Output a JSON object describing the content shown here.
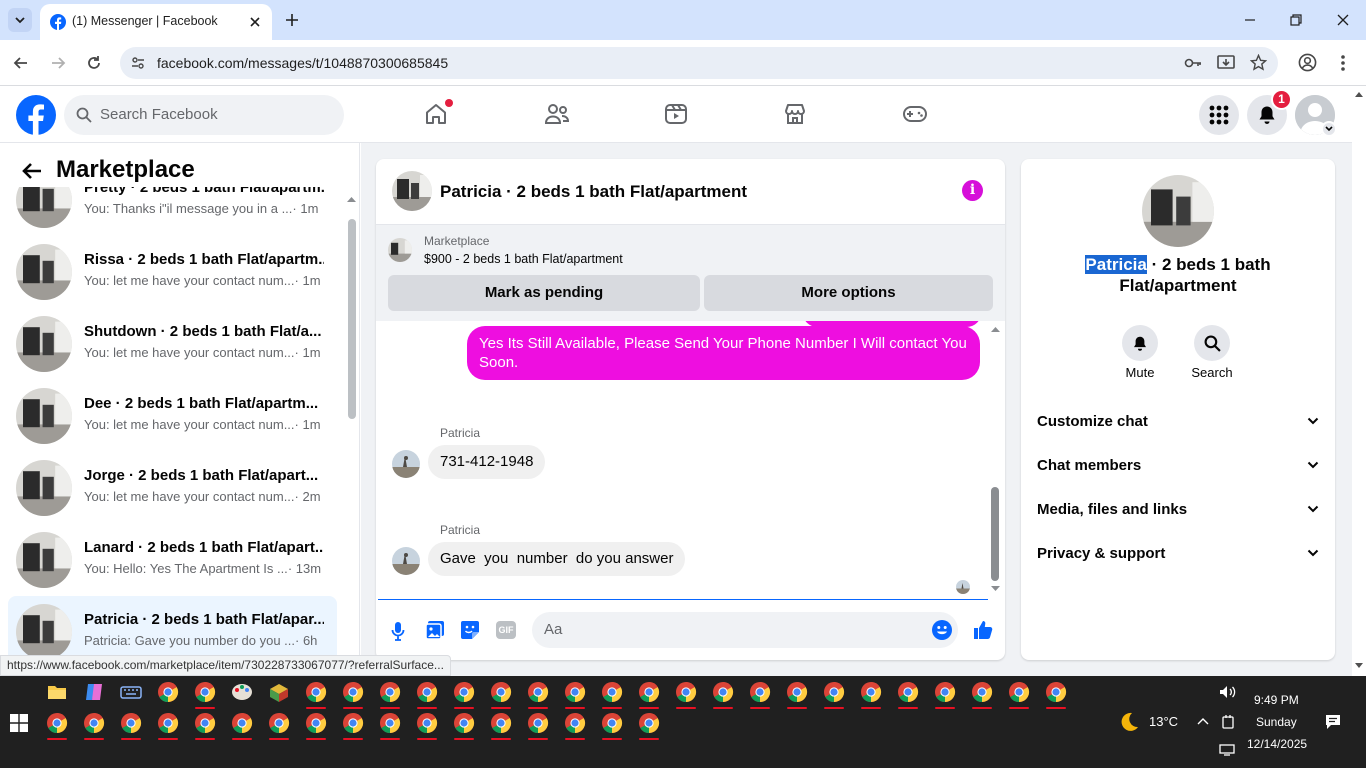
{
  "browser": {
    "tab_title": "(1) Messenger | Facebook",
    "url": "facebook.com/messages/t/1048870300685845",
    "status_url": "https://www.facebook.com/marketplace/item/730228733067077/?referralSurface..."
  },
  "fb": {
    "search_placeholder": "Search Facebook",
    "notif_count": "1"
  },
  "sidebar": {
    "title": "Marketplace",
    "conversations": [
      {
        "name": "Pretty · 2 beds 1 bath Flat/apartm...",
        "preview": "You: Thanks i\"il message you in a ...",
        "time": "· 1m"
      },
      {
        "name": "Rissa · 2 beds 1 bath Flat/apartm...",
        "preview": "You: let me have your contact num...",
        "time": "· 1m"
      },
      {
        "name": "Shutdown · 2 beds 1 bath Flat/a...",
        "preview": "You: let me have your contact num...",
        "time": "· 1m"
      },
      {
        "name": "Dee · 2 beds 1 bath Flat/apartm...",
        "preview": "You: let me have your contact num...",
        "time": "· 1m"
      },
      {
        "name": "Jorge · 2 beds 1 bath Flat/apart...",
        "preview": "You: let me have your contact num...",
        "time": "· 2m"
      },
      {
        "name": "Lanard · 2 beds 1 bath Flat/apart...",
        "preview": "You: Hello: Yes The Apartment Is ...",
        "time": "· 13m"
      },
      {
        "name": "Patricia · 2 beds 1 bath Flat/apar...",
        "preview": "Patricia: Gave you number do you ...",
        "time": "· 6h"
      }
    ]
  },
  "chat": {
    "title": "Patricia · 2 beds 1 bath Flat/apartment",
    "listing_label": "Marketplace",
    "listing_desc": "$900 - 2 beds 1 bath Flat/apartment",
    "mark_pending": "Mark as pending",
    "more_options": "More options",
    "messages": [
      {
        "from": "me",
        "text": "Yes Its Still Available, Please Send Your Phone Number I Will contact You Soon."
      },
      {
        "from": "Patricia",
        "sender": "Patricia",
        "text": "731-412-1948"
      },
      {
        "from": "Patricia",
        "sender": "Patricia",
        "text": "Gave  you  number  do you answer"
      }
    ],
    "composer_placeholder": "Aa"
  },
  "profile": {
    "name_highlight": "Patricia",
    "name_rest": " · 2 beds 1 bath",
    "name_line2": "Flat/apartment",
    "mute": "Mute",
    "search": "Search",
    "sections": [
      "Customize chat",
      "Chat members",
      "Media, files and links",
      "Privacy & support"
    ]
  },
  "taskbar": {
    "weather": "13°C",
    "time": "9:49 PM",
    "day": "Sunday",
    "date": "12/14/2025"
  },
  "colors": {
    "fb_blue": "#0866ff",
    "bubble_pink": "#ee0ee0",
    "accent_purple": "#d60fd9"
  }
}
